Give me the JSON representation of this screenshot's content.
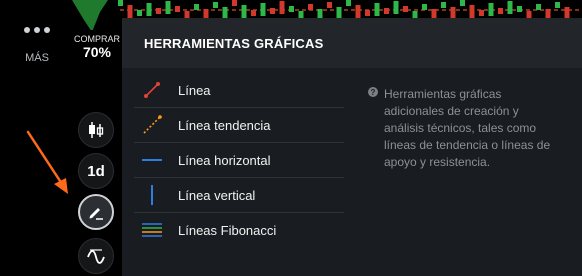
{
  "sidebar": {
    "more_label": "MÁS",
    "buy_label": "COMPRAR",
    "buy_percent": "70%",
    "timeframe_label": "1d",
    "buttons": {
      "candles": "candlestick-icon",
      "timeframe": "timeframe-button",
      "drawing": "pencil-icon",
      "indicators": "wave-icon"
    }
  },
  "panel": {
    "title": "HERRAMIENTAS GRÁFICAS",
    "tools": [
      {
        "label": "Línea",
        "icon": "line-tool-icon"
      },
      {
        "label": "Línea tendencia",
        "icon": "trend-line-icon"
      },
      {
        "label": "Línea horizontal",
        "icon": "horizontal-line-icon"
      },
      {
        "label": "Línea vertical",
        "icon": "vertical-line-icon"
      },
      {
        "label": "Líneas Fibonacci",
        "icon": "fibonacci-lines-icon"
      }
    ],
    "info_icon": "question-icon",
    "info_text": "Herramientas gráficas adicionales de creación y análisis técnicos, tales como líneas de tendencia o líneas de apoyo y resistencia."
  },
  "colors": {
    "accent": "#ff6a1a",
    "line_red": "#e0433a",
    "line_orange": "#ff9a1a",
    "line_blue": "#2f7de1",
    "candle_red": "#d2382c",
    "candle_green": "#2eb84a",
    "panel_bg": "#191c20",
    "panel_header_bg": "#22262b",
    "info_text": "#8b9196"
  }
}
